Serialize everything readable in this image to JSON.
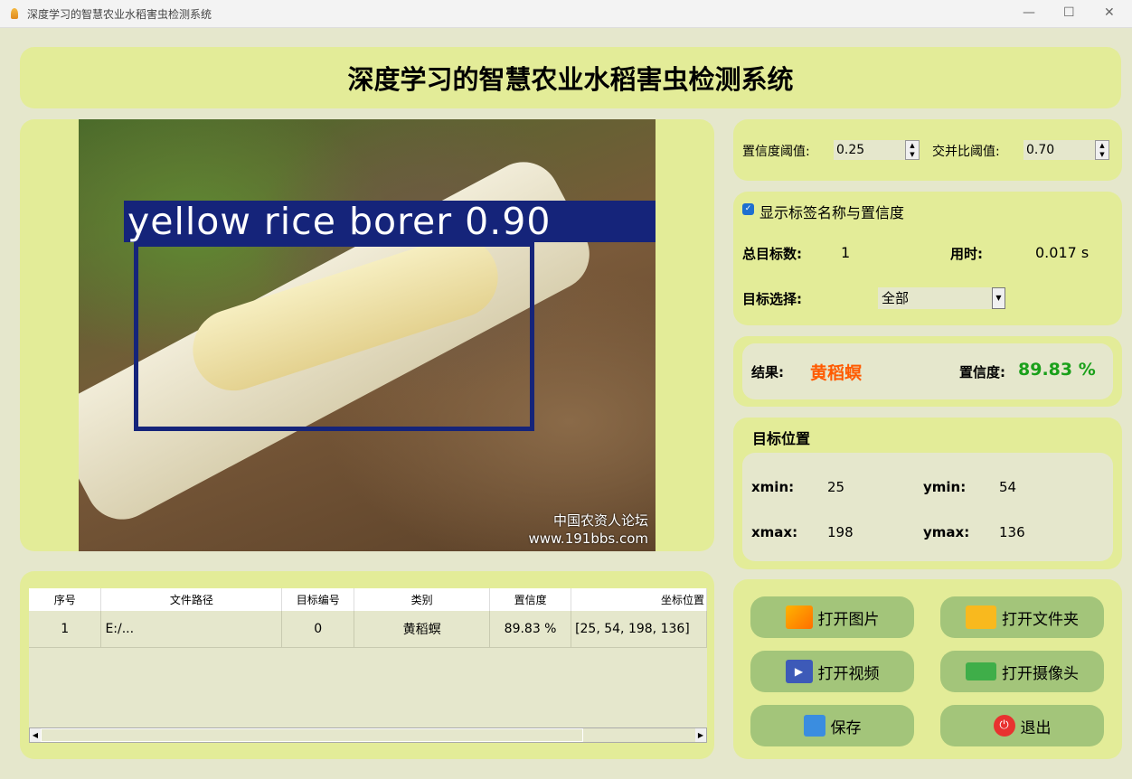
{
  "window": {
    "title": "深度学习的智慧农业水稻害虫检测系统",
    "minimize": "—",
    "maximize": "☐",
    "close": "✕"
  },
  "header": {
    "title": "深度学习的智慧农业水稻害虫检测系统"
  },
  "image": {
    "detection_label": "yellow rice borer 0.90",
    "watermark_line1": "中国农资人论坛",
    "watermark_line2": "www.191bbs.com"
  },
  "settings": {
    "conf_label": "置信度阈值:",
    "conf_value": "0.25",
    "iou_label": "交并比阈值:",
    "iou_value": "0.70"
  },
  "info": {
    "show_label_text": "显示标签名称与置信度",
    "show_label_checked": true,
    "total_label": "总目标数:",
    "total_value": "1",
    "time_label": "用时:",
    "time_value": "0.017 s",
    "select_label": "目标选择:",
    "select_value": "全部"
  },
  "result": {
    "result_label": "结果:",
    "result_value": "黄稻螟",
    "conf_label": "置信度:",
    "conf_value": "89.83 %",
    "result_color": "#ff5a00",
    "conf_color": "#1aa01a"
  },
  "position": {
    "title": "目标位置",
    "xmin_label": "xmin:",
    "xmin": "25",
    "ymin_label": "ymin:",
    "ymin": "54",
    "xmax_label": "xmax:",
    "xmax": "198",
    "ymax_label": "ymax:",
    "ymax": "136"
  },
  "buttons": {
    "open_image": "打开图片",
    "open_folder": "打开文件夹",
    "open_video": "打开视频",
    "open_camera": "打开摄像头",
    "save": "保存",
    "exit": "退出"
  },
  "table": {
    "headers": [
      "序号",
      "文件路径",
      "目标编号",
      "类别",
      "置信度",
      "坐标位置"
    ],
    "rows": [
      [
        "1",
        "E:/...",
        "0",
        "黄稻螟",
        "89.83 %",
        "[25, 54, 198, 136]"
      ]
    ]
  }
}
